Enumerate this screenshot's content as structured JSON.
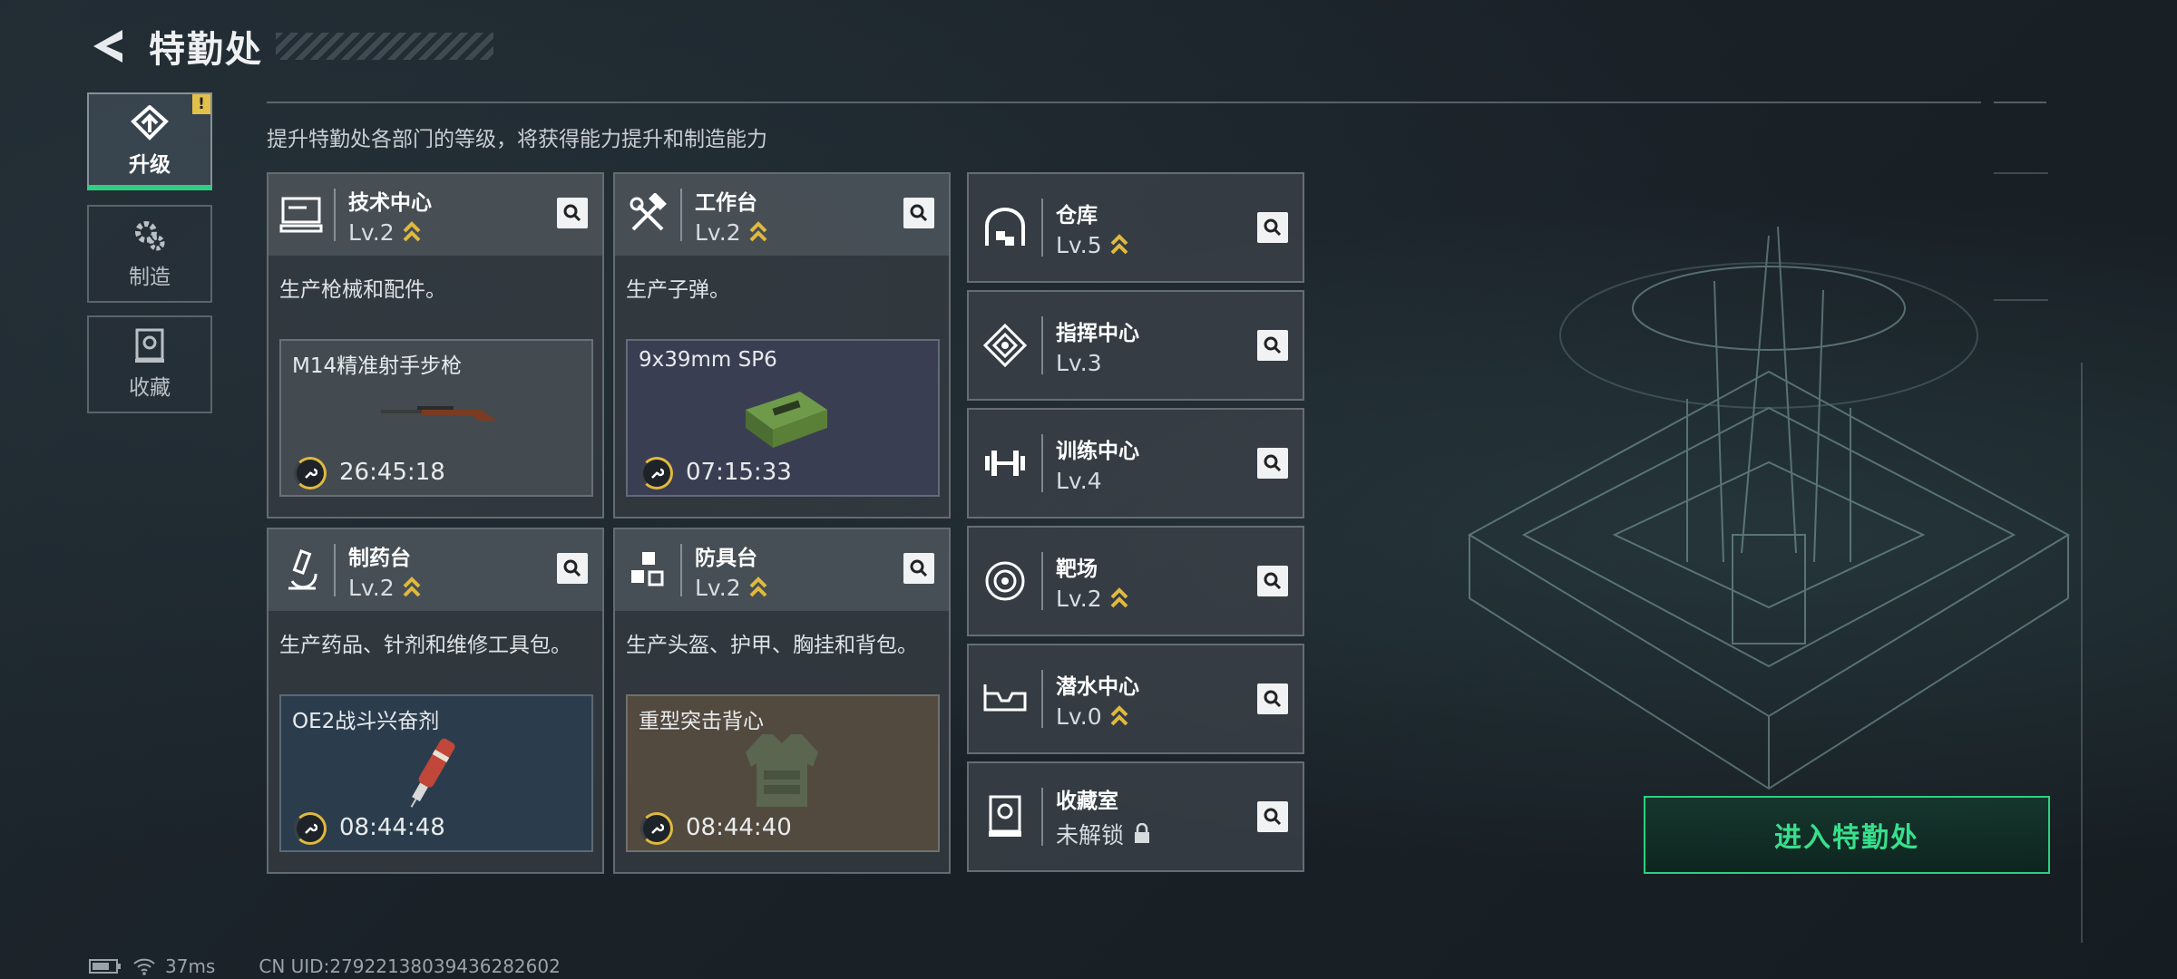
{
  "header": {
    "title": "特勤处"
  },
  "tabs": [
    {
      "label": "升级",
      "icon": "upgrade-icon",
      "active": true,
      "alert": "!"
    },
    {
      "label": "制造",
      "icon": "gear-icon",
      "active": false
    },
    {
      "label": "收藏",
      "icon": "collection-icon",
      "active": false
    }
  ],
  "subtitle": "提升特勤处各部门的等级，将获得能力提升和制造能力",
  "production_cards": [
    {
      "name": "技术中心",
      "level": "Lv.2",
      "desc": "生产枪械和配件。",
      "product": "M14精准射手步枪",
      "time": "26:45:18"
    },
    {
      "name": "工作台",
      "level": "Lv.2",
      "desc": "生产子弹。",
      "product": "9x39mm SP6",
      "time": "07:15:33"
    },
    {
      "name": "制药台",
      "level": "Lv.2",
      "desc": "生产药品、针剂和维修工具包。",
      "product": "OE2战斗兴奋剂",
      "time": "08:44:48"
    },
    {
      "name": "防具台",
      "level": "Lv.2",
      "desc": "生产头盔、护甲、胸挂和背包。",
      "product": "重型突击背心",
      "time": "08:44:40"
    }
  ],
  "facilities": [
    {
      "name": "仓库",
      "level": "Lv.5",
      "upgrade": true
    },
    {
      "name": "指挥中心",
      "level": "Lv.3",
      "upgrade": false
    },
    {
      "name": "训练中心",
      "level": "Lv.4",
      "upgrade": false
    },
    {
      "name": "靶场",
      "level": "Lv.2",
      "upgrade": true
    },
    {
      "name": "潜水中心",
      "level": "Lv.0",
      "upgrade": true
    },
    {
      "name": "收藏室",
      "level": "未解锁",
      "locked": true
    }
  ],
  "enter_button": "进入特勤处",
  "status": {
    "ping": "37ms",
    "uid": "CN UID:27922138039436282602"
  },
  "colors": {
    "accent_green": "#2ed07f",
    "upgrade_gold": "#e0b93e"
  }
}
